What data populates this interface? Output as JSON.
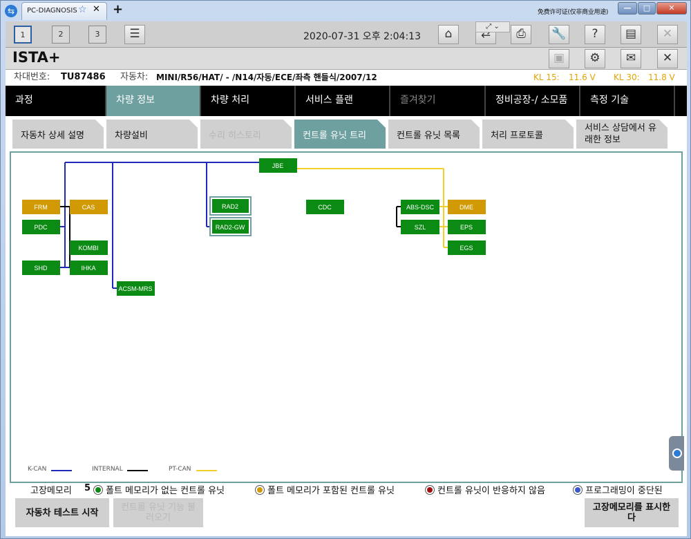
{
  "window": {
    "tab_title": "PC-DIAGNOSIS",
    "license_text": "免费许可证(仅非商业用途)",
    "controls": [
      "—",
      "□",
      "✕"
    ]
  },
  "toolbar": {
    "nav_numbers": [
      "1",
      "2",
      "3"
    ],
    "datetime": "2020-07-31 오후 2:04:13"
  },
  "app": {
    "title": "ISTA+"
  },
  "vehicle": {
    "vin_label": "차대번호:",
    "vin_value": "TU87486",
    "car_label": "자동차:",
    "car_value": "MINI/R56/HAT/ - /N14/자동/ECE/좌측 핸들식/2007/12",
    "kl15_label": "KL 15:",
    "kl15_value": "11.6 V",
    "kl30_label": "KL 30:",
    "kl30_value": "11.8 V"
  },
  "main_nav": [
    {
      "label": "과정",
      "state": "normal"
    },
    {
      "label": "차량 정보",
      "state": "active"
    },
    {
      "label": "차량 처리",
      "state": "normal"
    },
    {
      "label": "서비스 플랜",
      "state": "normal"
    },
    {
      "label": "즐겨찾기",
      "state": "disabled"
    },
    {
      "label": "정비공장-/ 소모품",
      "state": "normal"
    },
    {
      "label": "측정 기술",
      "state": "normal"
    }
  ],
  "sub_nav": [
    {
      "label": "자동차 상세 설명",
      "state": "normal"
    },
    {
      "label": "차량설비",
      "state": "normal"
    },
    {
      "label": "수리 히스토리",
      "state": "disabled"
    },
    {
      "label": "컨트롤 유닛 트리",
      "state": "active"
    },
    {
      "label": "컨트롤 유닛 목록",
      "state": "normal"
    },
    {
      "label": "처리 프로토콜",
      "state": "normal"
    },
    {
      "label": "서비스 상담에서 유래한 정보",
      "state": "normal"
    }
  ],
  "colors": {
    "ok": "#0b8a14",
    "fault": "#d19a05",
    "k_can": "#1f2bb8",
    "internal": "#000000",
    "pt_can": "#f2d02a",
    "accent": "#6fa0a0"
  },
  "ecus": [
    {
      "id": "JBE",
      "status": "ok"
    },
    {
      "id": "FRM",
      "status": "fault"
    },
    {
      "id": "CAS",
      "status": "fault"
    },
    {
      "id": "PDC",
      "status": "ok"
    },
    {
      "id": "KOMBI",
      "status": "ok"
    },
    {
      "id": "SHD",
      "status": "ok"
    },
    {
      "id": "IHKA",
      "status": "ok"
    },
    {
      "id": "ACSM-MRS",
      "status": "ok"
    },
    {
      "id": "RAD2",
      "status": "ok"
    },
    {
      "id": "RAD2-GW",
      "status": "ok"
    },
    {
      "id": "CDC",
      "status": "ok"
    },
    {
      "id": "ABS-DSC",
      "status": "ok"
    },
    {
      "id": "SZL",
      "status": "ok"
    },
    {
      "id": "DME",
      "status": "fault"
    },
    {
      "id": "EPS",
      "status": "ok"
    },
    {
      "id": "EGS",
      "status": "ok"
    }
  ],
  "legend": [
    {
      "label": "K-CAN",
      "color": "#1f2bb8"
    },
    {
      "label": "INTERNAL",
      "color": "#000000"
    },
    {
      "label": "PT-CAN",
      "color": "#f2d02a"
    }
  ],
  "status_row": {
    "fault_memory_label": "고장메모리",
    "fault_memory_count": "5",
    "items": [
      {
        "label": "폴트 메모리가 없는 컨트롤 유닛",
        "color": "#0b8a14"
      },
      {
        "label": "폴트 메모리가 포함된 컨트롤 유닛",
        "color": "#d19a05"
      },
      {
        "label": "컨트롤 유닛이 반응하지 않음",
        "color": "#a01010"
      },
      {
        "label": "프로그래밍이 중단된",
        "color": "#3a58c8"
      }
    ]
  },
  "buttons": {
    "vehicle_test": "자동차 테스트 시작",
    "call_function": "컨트롤 유닛 기능 불러오기",
    "show_fault_memory": "고장메모리를 표시한다"
  }
}
